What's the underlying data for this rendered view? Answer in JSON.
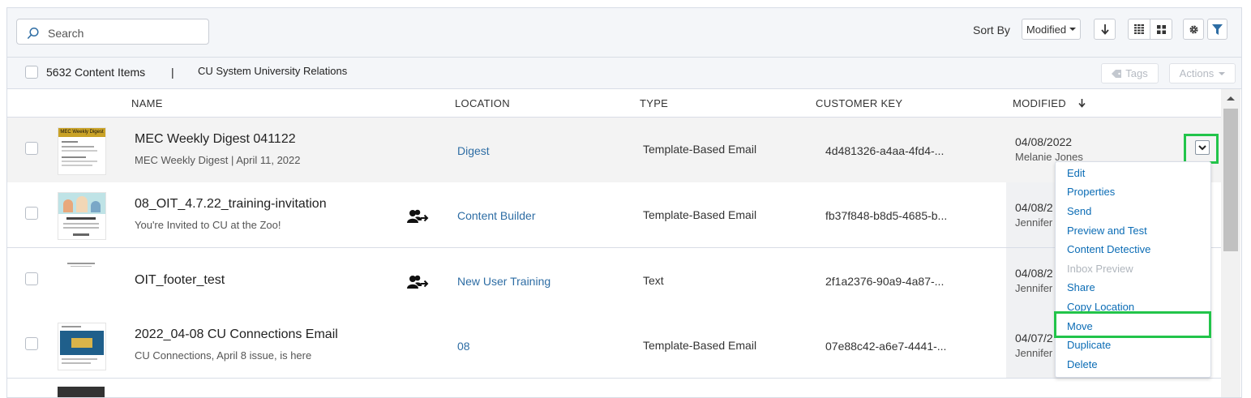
{
  "search": {
    "placeholder": "Search"
  },
  "toolbar": {
    "sort_by_label": "Sort By",
    "sort_value": "Modified"
  },
  "subbar": {
    "count_label": "5632 Content Items",
    "separator": "|",
    "business_unit": "CU System University Relations",
    "tags_label": "Tags",
    "actions_label": "Actions"
  },
  "columns": {
    "name": "NAME",
    "location": "LOCATION",
    "type": "TYPE",
    "customer_key": "CUSTOMER KEY",
    "modified": "MODIFIED"
  },
  "rows": [
    {
      "name": "MEC Weekly Digest 041122",
      "subtitle": "MEC Weekly Digest | April 11, 2022",
      "location": "Digest",
      "type": "Template-Based Email",
      "key": "4d481326-a4aa-4fd4-...",
      "modified": "04/08/2022",
      "user": "Melanie Jones",
      "shared": false,
      "thumb_title": "MEC Weekly Digest"
    },
    {
      "name": "08_OIT_4.7.22_training-invitation",
      "subtitle": "You're Invited to CU at the Zoo!",
      "location": "Content Builder",
      "type": "Template-Based Email",
      "key": "fb37f848-b8d5-4685-b...",
      "modified": "04/08/2",
      "user": "Jennifer",
      "shared": true
    },
    {
      "name": "OIT_footer_test",
      "subtitle": "",
      "location": "New User Training",
      "type": "Text",
      "key": "2f1a2376-90a9-4a87-...",
      "modified": "04/08/2",
      "user": "Jennifer",
      "shared": true
    },
    {
      "name": "2022_04-08 CU Connections Email",
      "subtitle": "CU Connections, April 8 issue, is here",
      "location": "08",
      "type": "Template-Based Email",
      "key": "07e88c42-a6e7-4441-...",
      "modified": "04/07/2",
      "user": "Jennifer",
      "shared": false
    }
  ],
  "menu": {
    "items": [
      {
        "label": "Edit",
        "disabled": false
      },
      {
        "label": "Properties",
        "disabled": false
      },
      {
        "label": "Send",
        "disabled": false
      },
      {
        "label": "Preview and Test",
        "disabled": false
      },
      {
        "label": "Content Detective",
        "disabled": false
      },
      {
        "label": "Inbox Preview",
        "disabled": true
      },
      {
        "label": "Share",
        "disabled": false
      },
      {
        "label": "Copy Location",
        "disabled": false
      },
      {
        "label": "Move",
        "disabled": false
      },
      {
        "label": "Duplicate",
        "disabled": false
      },
      {
        "label": "Delete",
        "disabled": false
      }
    ]
  },
  "colors": {
    "link": "#0b6cb5",
    "highlight": "#22c44a",
    "location": "#2e6da4"
  },
  "icons": {
    "search": "search-icon",
    "sort_direction": "arrow-down-icon",
    "list_view": "list-view-icon",
    "grid_view": "grid-view-icon",
    "settings": "gear-icon",
    "filter": "filter-icon",
    "tag": "tag-icon",
    "share": "shared-users-icon",
    "row_menu": "chevron-down-icon"
  }
}
